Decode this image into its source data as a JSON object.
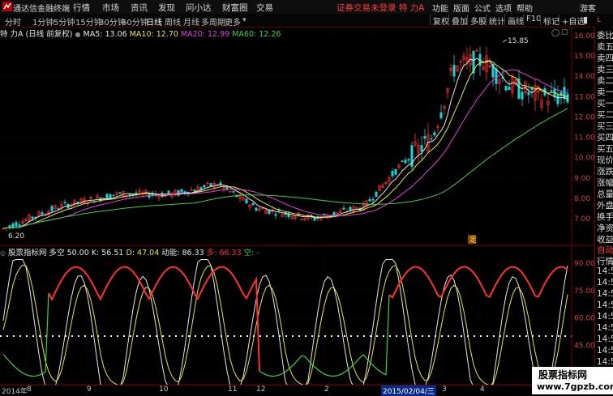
{
  "app": {
    "name": "通达信金融终端"
  },
  "menu": [
    "行情",
    "市场",
    "资讯",
    "发现",
    "问小达",
    "财富圈",
    "交易"
  ],
  "status": "证券交易未登录  特 力A",
  "right_menu": [
    "功能",
    "版面",
    "公式",
    "选项",
    "帮助",
    "游客"
  ],
  "periods": [
    {
      "label": "分时",
      "active": false
    },
    {
      "label": "1分钟",
      "active": false
    },
    {
      "label": "5分钟",
      "active": false
    },
    {
      "label": "15分钟",
      "active": false
    },
    {
      "label": "30分钟",
      "active": false
    },
    {
      "label": "60分钟",
      "active": false
    },
    {
      "label": "日线",
      "active": true
    },
    {
      "label": "周线",
      "active": false
    },
    {
      "label": "月线",
      "active": false
    },
    {
      "label": "多周期",
      "active": false
    },
    {
      "label": "更多",
      "active": false
    }
  ],
  "toolbar_right": [
    "复权",
    "叠加",
    "多股",
    "统计",
    "画线",
    "F10",
    "标记",
    "+自选"
  ],
  "main_legend": {
    "title": "特 力A (日线 前复权)",
    "ma": [
      {
        "label": "MA5: 13.06",
        "color": "#e8e8e8"
      },
      {
        "label": "MA10: 12.70",
        "color": "#e8e840"
      },
      {
        "label": "MA20: 12.99",
        "color": "#e040e0"
      },
      {
        "label": "MA60: 12.26",
        "color": "#40d040"
      }
    ]
  },
  "price_axis": [
    "16.00",
    "15.00",
    "14.00",
    "13.00",
    "12.00",
    "11.00",
    "10.00",
    "9.00",
    "8.00",
    "7.00"
  ],
  "annotations": {
    "high": "15.85",
    "low": "6.20",
    "marker": "定"
  },
  "indicator_legend": {
    "title": "股票指标网 多空",
    "items": [
      {
        "label": "50.00",
        "color": "#e8e8e8"
      },
      {
        "label": "K: 56.51",
        "color": "#e8e8e8"
      },
      {
        "label": "D: 47.04",
        "color": "#e8e840"
      },
      {
        "label": "动能: 86.33",
        "color": "#e8e8e8"
      },
      {
        "label": "多: 66.33",
        "color": "#ff3030"
      },
      {
        "label": "空: -",
        "color": "#40d040"
      }
    ]
  },
  "indicator_axis": [
    "90.00",
    "75.00",
    "60.00",
    "45.00",
    "30.00"
  ],
  "right_panel": [
    "委比",
    "卖五",
    "卖四",
    "卖三",
    "卖二",
    "卖一",
    "买一",
    "买二",
    "买三",
    "买四",
    "买五",
    "现价",
    "涨跌",
    "涨幅",
    "总量",
    "外盘",
    "换手",
    "净资",
    "收益",
    "自动",
    "行情",
    "14:5",
    "14:5",
    "14:5",
    "14:5",
    "14:5",
    "14:5",
    "14:5",
    "14:5",
    "14:5"
  ],
  "right_panel_prefix": "L",
  "dates": [
    {
      "label": "2014年",
      "highlight": false
    },
    {
      "label": "8",
      "highlight": false
    },
    {
      "label": "9",
      "highlight": false
    },
    {
      "label": "10",
      "highlight": false
    },
    {
      "label": "11",
      "highlight": false
    },
    {
      "label": "12",
      "highlight": false
    },
    {
      "label": "2",
      "highlight": false
    },
    {
      "label": "2015/02/04/三",
      "highlight": true
    },
    {
      "label": "3",
      "highlight": false
    },
    {
      "label": "4",
      "highlight": false
    }
  ],
  "watermark": {
    "line1": "股票指标网",
    "line2": "www.7gpzb.com"
  },
  "colors": {
    "up": "#ff3030",
    "down": "#20d0d0",
    "ma5": "#e8e8e8",
    "ma10": "#e8e840",
    "ma20": "#e040e0",
    "ma60": "#40d040",
    "border": "#7a0000"
  }
}
